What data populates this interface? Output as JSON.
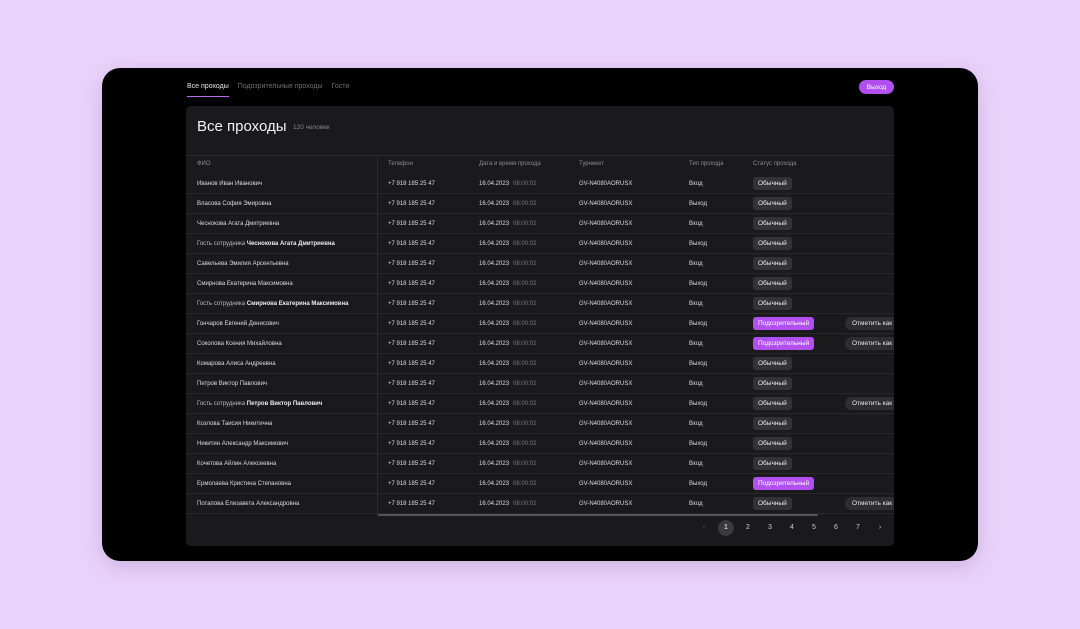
{
  "nav": {
    "tabs": [
      {
        "label": "Все проходы",
        "active": true
      },
      {
        "label": "Подозрительные проходы",
        "active": false
      },
      {
        "label": "Гости",
        "active": false
      }
    ],
    "logout_label": "Выход"
  },
  "panel": {
    "title": "Все проходы",
    "count": "120 человек"
  },
  "table": {
    "columns": [
      "ФИО",
      "Телефон",
      "Дата и время прохода",
      "Турникет",
      "Тип прохода",
      "Статус прохода"
    ],
    "rows": [
      {
        "guest_prefix": "",
        "name": "Иванов Иван Иванович",
        "phone": "+7 918 185 25 47",
        "date": "16.04.2023",
        "time": "08:00:02",
        "turnstile": "GV-N4080AORUSX",
        "type": "Вход",
        "status": "Обычный",
        "suspect": false,
        "action": ""
      },
      {
        "guest_prefix": "",
        "name": "Власова София Эмировна",
        "phone": "+7 918 185 25 47",
        "date": "16.04.2023",
        "time": "08:00:02",
        "turnstile": "GV-N4080AORUSX",
        "type": "Выход",
        "status": "Обычный",
        "suspect": false,
        "action": ""
      },
      {
        "guest_prefix": "",
        "name": "Чеснокова Агата Дмитриевна",
        "phone": "+7 918 185 25 47",
        "date": "16.04.2023",
        "time": "08:00:02",
        "turnstile": "GV-N4080AORUSX",
        "type": "Вход",
        "status": "Обычный",
        "suspect": false,
        "action": ""
      },
      {
        "guest_prefix": "Гость сотрудника",
        "name": "Чеснокова Агата Дмитриевна",
        "phone": "+7 918 185 25 47",
        "date": "16.04.2023",
        "time": "08:00:02",
        "turnstile": "GV-N4080AORUSX",
        "type": "Выход",
        "status": "Обычный",
        "suspect": false,
        "action": ""
      },
      {
        "guest_prefix": "",
        "name": "Савельева Эмилия Арсентьевна",
        "phone": "+7 918 185 25 47",
        "date": "16.04.2023",
        "time": "08:00:02",
        "turnstile": "GV-N4080AORUSX",
        "type": "Вход",
        "status": "Обычный",
        "suspect": false,
        "action": ""
      },
      {
        "guest_prefix": "",
        "name": "Смирнова Екатерина Максимовна",
        "phone": "+7 918 185 25 47",
        "date": "16.04.2023",
        "time": "08:00:02",
        "turnstile": "GV-N4080AORUSX",
        "type": "Выход",
        "status": "Обычный",
        "suspect": false,
        "action": ""
      },
      {
        "guest_prefix": "Гость сотрудника",
        "name": "Смирнова Екатерина Максимовна",
        "phone": "+7 918 185 25 47",
        "date": "16.04.2023",
        "time": "08:00:02",
        "turnstile": "GV-N4080AORUSX",
        "type": "Вход",
        "status": "Обычный",
        "suspect": false,
        "action": ""
      },
      {
        "guest_prefix": "",
        "name": "Гончаров Евгений Денисович",
        "phone": "+7 918 185 25 47",
        "date": "16.04.2023",
        "time": "08:00:02",
        "turnstile": "GV-N4080AORUSX",
        "type": "Выход",
        "status": "Подозрительный",
        "suspect": true,
        "action": "Отметить как"
      },
      {
        "guest_prefix": "",
        "name": "Соколова Ксения Михайловна",
        "phone": "+7 918 185 25 47",
        "date": "16.04.2023",
        "time": "08:00:02",
        "turnstile": "GV-N4080AORUSX",
        "type": "Вход",
        "status": "Подозрительный",
        "suspect": true,
        "action": "Отметить как"
      },
      {
        "guest_prefix": "",
        "name": "Комарова Алиса Андреевна",
        "phone": "+7 918 185 25 47",
        "date": "16.04.2023",
        "time": "08:00:02",
        "turnstile": "GV-N4080AORUSX",
        "type": "Выход",
        "status": "Обычный",
        "suspect": false,
        "action": ""
      },
      {
        "guest_prefix": "",
        "name": "Петров Виктор Павлович",
        "phone": "+7 918 185 25 47",
        "date": "16.04.2023",
        "time": "08:00:02",
        "turnstile": "GV-N4080AORUSX",
        "type": "Вход",
        "status": "Обычный",
        "suspect": false,
        "action": ""
      },
      {
        "guest_prefix": "Гость сотрудника",
        "name": "Петров Виктор Павлович",
        "phone": "+7 918 185 25 47",
        "date": "16.04.2023",
        "time": "08:00:02",
        "turnstile": "GV-N4080AORUSX",
        "type": "Выход",
        "status": "Обычный",
        "suspect": false,
        "action": "Отметить как"
      },
      {
        "guest_prefix": "",
        "name": "Козлова Таисия Никитична",
        "phone": "+7 918 185 25 47",
        "date": "16.04.2023",
        "time": "08:00:02",
        "turnstile": "GV-N4080AORUSX",
        "type": "Вход",
        "status": "Обычный",
        "suspect": false,
        "action": ""
      },
      {
        "guest_prefix": "",
        "name": "Никитин Александр Максимович",
        "phone": "+7 918 185 25 47",
        "date": "16.04.2023",
        "time": "08:00:02",
        "turnstile": "GV-N4080AORUSX",
        "type": "Выход",
        "status": "Обычный",
        "suspect": false,
        "action": ""
      },
      {
        "guest_prefix": "",
        "name": "Кочетова Айлин Алексеевна",
        "phone": "+7 918 185 25 47",
        "date": "16.04.2023",
        "time": "08:00:02",
        "turnstile": "GV-N4080AORUSX",
        "type": "Вход",
        "status": "Обычный",
        "suspect": false,
        "action": ""
      },
      {
        "guest_prefix": "",
        "name": "Ермолаева Кристина Степановна",
        "phone": "+7 918 185 25 47",
        "date": "16.04.2023",
        "time": "08:00:02",
        "turnstile": "GV-N4080AORUSX",
        "type": "Выход",
        "status": "Подозрительный",
        "suspect": true,
        "action": ""
      },
      {
        "guest_prefix": "",
        "name": "Потапова Елизавета Александровна",
        "phone": "+7 918 185 25 47",
        "date": "16.04.2023",
        "time": "08:00:02",
        "turnstile": "GV-N4080AORUSX",
        "type": "Вход",
        "status": "Обычный",
        "suspect": false,
        "action": "Отметить как"
      }
    ]
  },
  "pagination": {
    "prev_icon": "chevron-left-icon",
    "next_icon": "chevron-right-icon",
    "prev_glyph": "‹",
    "next_glyph": "›",
    "pages": [
      "1",
      "2",
      "3",
      "4",
      "5",
      "6",
      "7"
    ],
    "current": "1"
  },
  "colors": {
    "accent": "#b14ff0",
    "background": "#ead3fa",
    "panel": "#1a1a1c",
    "badge_normal": "#333337"
  }
}
